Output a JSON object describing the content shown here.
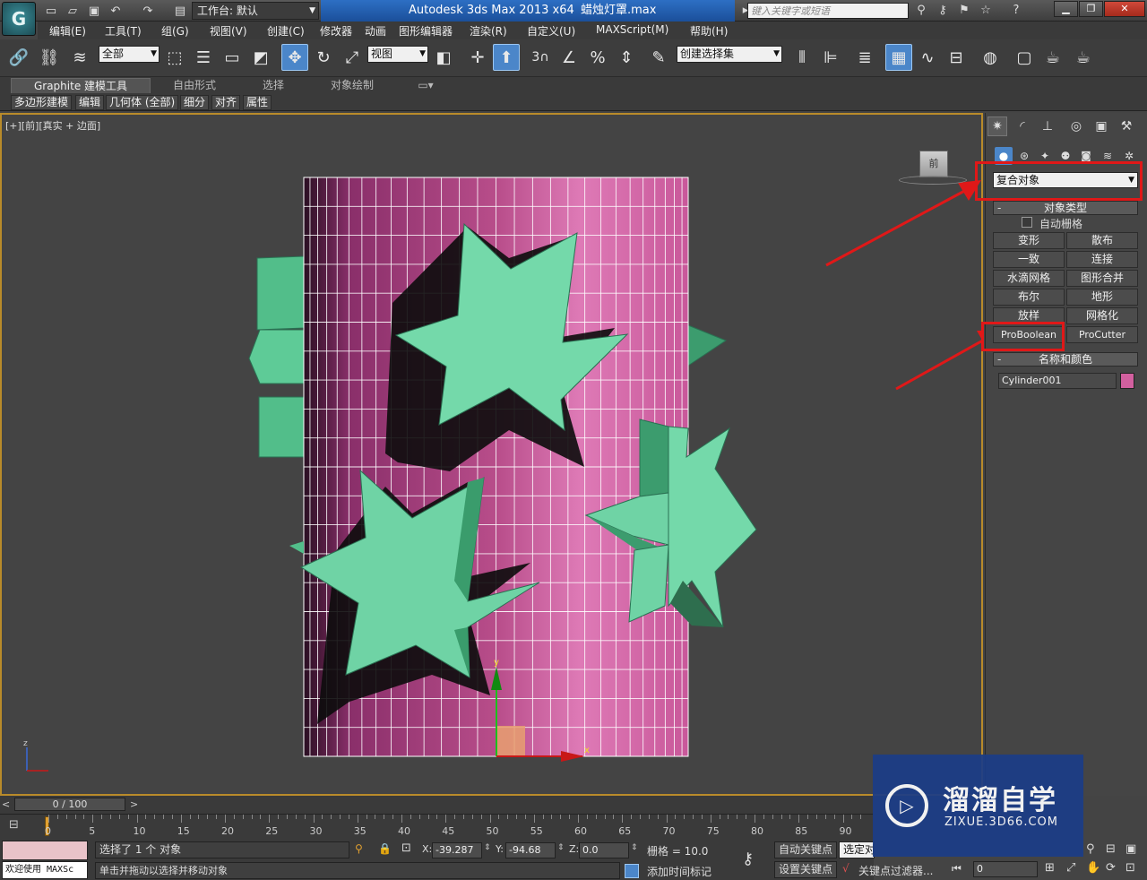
{
  "titlebar": {
    "workspace": "工作台: 默认",
    "app_title": "Autodesk 3ds Max  2013 x64",
    "file_title": "蜡烛灯罩.max",
    "search_placeholder": "键入关键字或短语"
  },
  "menu": [
    "编辑(E)",
    "工具(T)",
    "组(G)",
    "视图(V)",
    "创建(C)",
    "修改器",
    "动画",
    "图形编辑器",
    "渲染(R)",
    "自定义(U)",
    "MAXScript(M)",
    "帮助(H)"
  ],
  "toolbar": {
    "selection_filter": "全部",
    "coord_system": "视图",
    "snap_label": "3",
    "named_selection": "创建选择集"
  },
  "ribbon": {
    "tabs": [
      "Graphite 建模工具",
      "自由形式",
      "选择",
      "对象绘制"
    ],
    "sub": [
      "多边形建模",
      "编辑",
      "几何体 (全部)",
      "细分",
      "对齐",
      "属性"
    ]
  },
  "viewport": {
    "label": "[+][前][真实 + 边面]",
    "viewcube_label": "前",
    "gizmo_y": "y",
    "gizmo_x": "x",
    "axis_z": "z",
    "cylinder_color": "#d2609f",
    "star_color": "#6fd3a6"
  },
  "panel": {
    "compound_dropdown": "复合对象",
    "object_type_header": "对象类型",
    "autogrid_label": "自动栅格",
    "buttons": [
      "变形",
      "散布",
      "一致",
      "连接",
      "水滴网格",
      "图形合并",
      "布尔",
      "地形",
      "放样",
      "网格化",
      "ProBoolean",
      "ProCutter"
    ],
    "name_color_header": "名称和颜色",
    "object_name": "Cylinder001",
    "object_color": "#d2609f"
  },
  "timeline": {
    "slider": "0 / 100",
    "ticks": [
      "0",
      "5",
      "10",
      "15",
      "20",
      "25",
      "30",
      "35",
      "40",
      "45",
      "50",
      "55",
      "60",
      "65",
      "70",
      "75",
      "80",
      "85",
      "90"
    ]
  },
  "status": {
    "selected": "选择了 1 个 对象",
    "hint": "单击并拖动以选择并移动对象",
    "welcome": "欢迎使用 MAXSc",
    "x": "-39.287",
    "y": "-94.68",
    "z": "0.0",
    "grid": "栅格 = 10.0",
    "auto_key": "自动关键点",
    "set_key": "设置关键点",
    "selected_set": "选定对",
    "key_filter": "关键点过滤器...",
    "add_time_tag": "添加时间标记",
    "frame": "0"
  },
  "watermark": {
    "cn": "溜溜自学",
    "en": "ZIXUE.3D66.COM"
  }
}
